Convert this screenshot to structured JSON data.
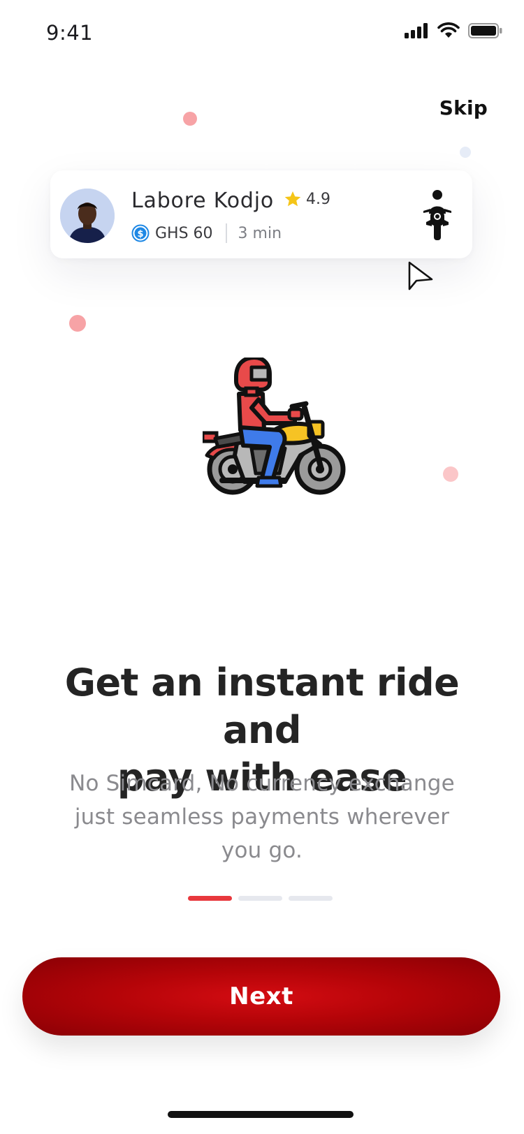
{
  "status_bar": {
    "time": "9:41"
  },
  "header": {
    "skip_label": "Skip"
  },
  "driver_card": {
    "name": "Labore  Kodjo",
    "rating": "4.9",
    "fare": "GHS 60",
    "eta": "3 min"
  },
  "onboarding": {
    "headline_line1": "Get an instant ride and",
    "headline_line2": "pay with ease",
    "subtitle_line1": "No Simcard, No currency exchange",
    "subtitle_line2": "just seamless payments wherever",
    "subtitle_line3": "you go.",
    "pages_total": 3,
    "current_page": 1
  },
  "footer": {
    "next_label": "Next"
  },
  "colors": {
    "brand_red": "#b40408",
    "accent_red": "#e8383d",
    "dot_pink": "#f7a3a6",
    "dot_blue": "#e6ecf7",
    "star": "#f5c518",
    "coin_blue": "#1e88e5"
  },
  "icons": [
    "signal-icon",
    "wifi-icon",
    "battery-icon",
    "star-icon",
    "dollar-coin-icon",
    "motorbike-rider-icon",
    "cursor-arrow-icon",
    "motorbike-illustration"
  ]
}
